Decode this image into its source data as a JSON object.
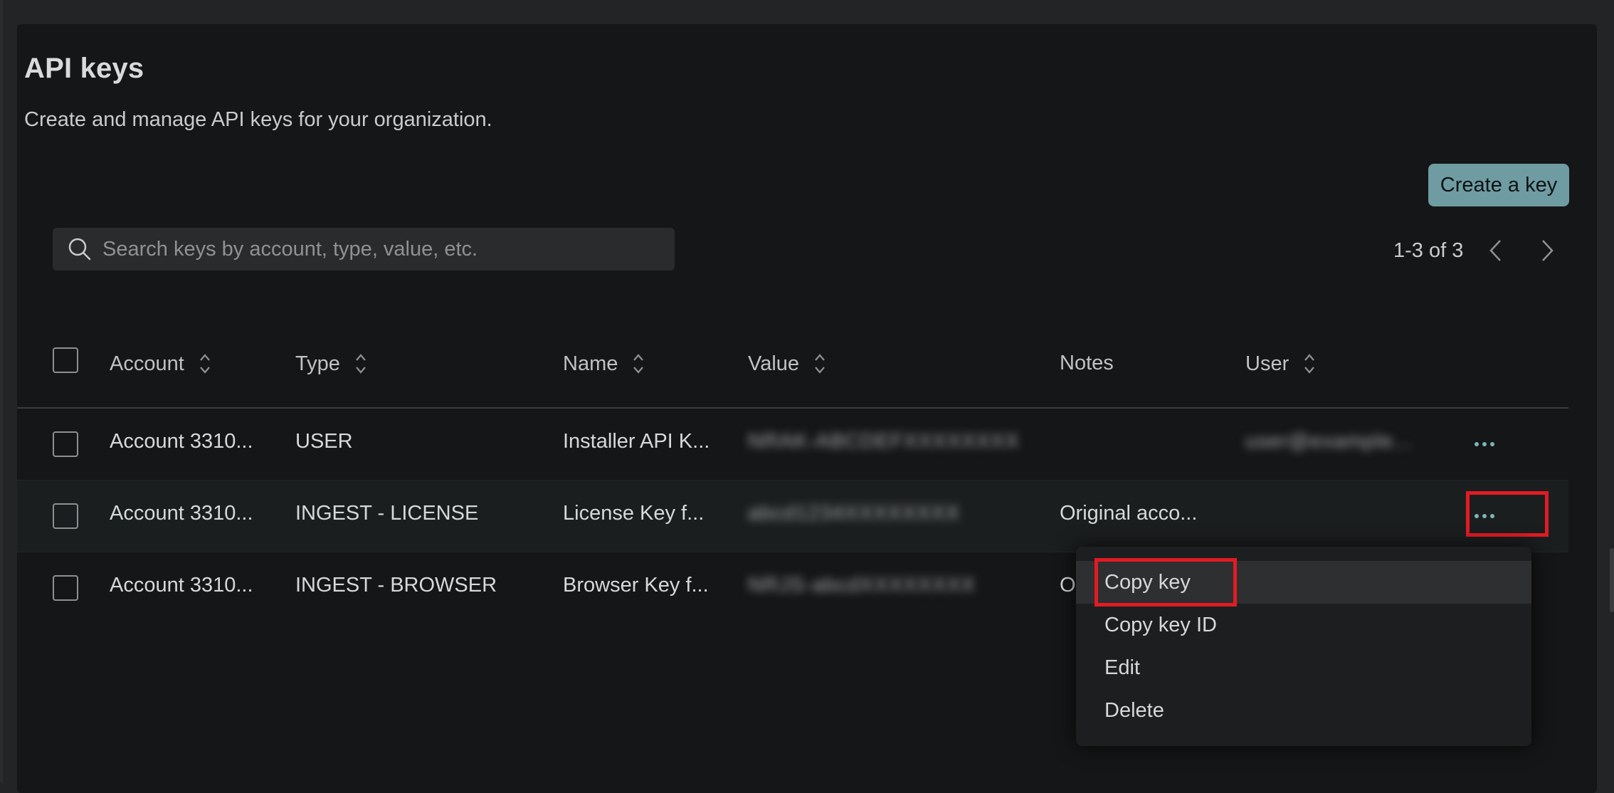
{
  "page": {
    "title": "API keys",
    "subtitle": "Create and manage API keys for your organization."
  },
  "toolbar": {
    "create_label": "Create a key",
    "search_placeholder": "Search keys by account, type, value, etc.",
    "pagination_text": "1-3 of 3"
  },
  "table": {
    "headers": {
      "account": "Account",
      "type": "Type",
      "name": "Name",
      "value": "Value",
      "notes": "Notes",
      "user": "User"
    },
    "rows": [
      {
        "account": "Account 3310...",
        "type": "USER",
        "name": "Installer API K...",
        "value": "NRAK-ABCDEFXXXXXXXX",
        "notes": "",
        "user": "user@example..."
      },
      {
        "account": "Account 3310...",
        "type": "INGEST - LICENSE",
        "name": "License Key f...",
        "value": "abcd1234XXXXXXXX",
        "notes": "Original acco...",
        "user": ""
      },
      {
        "account": "Account 3310...",
        "type": "INGEST - BROWSER",
        "name": "Browser Key f...",
        "value": "NRJS-abcdXXXXXXXX",
        "notes": "O",
        "user": ""
      }
    ]
  },
  "menu": {
    "items": [
      "Copy key",
      "Copy key ID",
      "Edit",
      "Delete"
    ]
  },
  "colors": {
    "accent": "#6e9ca2",
    "highlight_box": "#e21b23",
    "background": "#151617"
  },
  "icons": [
    "search-icon",
    "chevron-left-icon",
    "chevron-right-icon",
    "sort-icon",
    "more-horizontal-icon"
  ]
}
